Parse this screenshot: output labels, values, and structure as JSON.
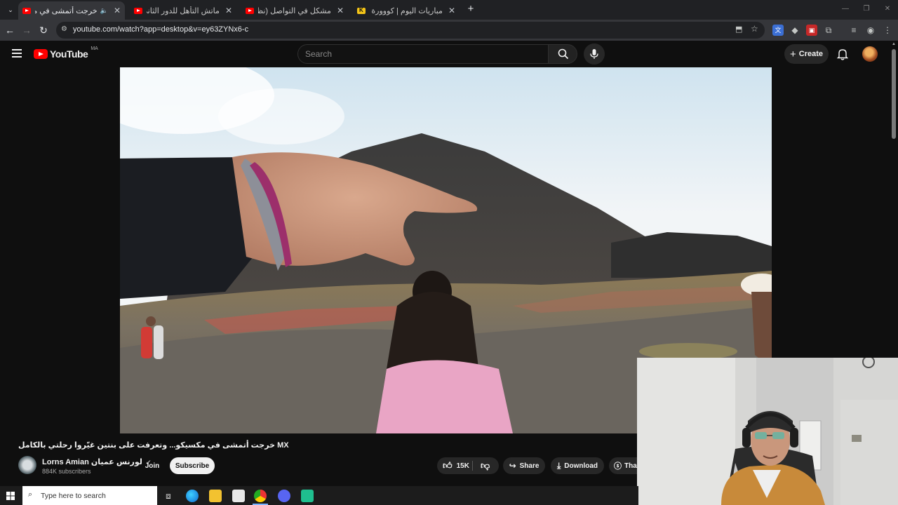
{
  "browser": {
    "tabs": [
      {
        "title": "خرجت أتمشى في مكسيكو...",
        "active": true,
        "muted_icon": "🔈"
      },
      {
        "title": "ماتش التأهل للدور الثاني؟ التشك",
        "active": false
      },
      {
        "title": "مشكل في التواصل (نظرية البراك",
        "active": false
      },
      {
        "title": "مباريات اليوم | كووورة",
        "active": false
      }
    ],
    "new_tab": "+",
    "url": "youtube.com/watch?app=desktop&v=ey63ZYNx6-c"
  },
  "youtube": {
    "logo": "YouTube",
    "region": "MA",
    "search_placeholder": "Search",
    "create_label": "Create"
  },
  "video": {
    "title": "خرجت أتمشى في مكسيكو... وتعرفت على بنتين غيّروا رحلتي بالكامل MX",
    "channel": "Lorns Amian لورنس عميان",
    "subscribers": "884K subscribers",
    "join_label": "Join",
    "subscribe_label": "Subscribe",
    "likes": "15K",
    "share_label": "Share",
    "download_label": "Download",
    "thanks_label": "Tha"
  },
  "taskbar": {
    "search_placeholder": "Type here to search"
  },
  "colors": {
    "youtube_red": "#ff0000",
    "background": "#0f0f0f",
    "chrome_frame": "#202124"
  }
}
